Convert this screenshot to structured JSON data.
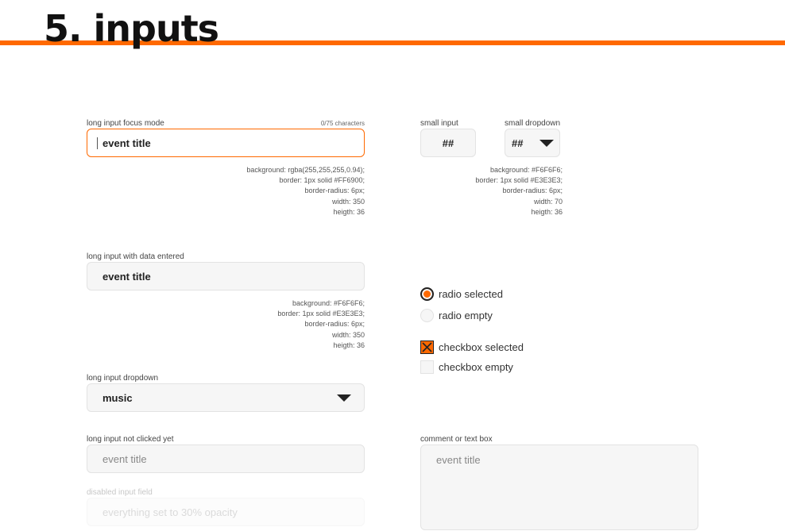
{
  "page": {
    "title": "5. inputs"
  },
  "focus_input": {
    "label": "long input focus mode",
    "counter": "0/75 characters",
    "value": "event title",
    "spec": [
      "background: rgba(255,255,255,0.94);",
      "border: 1px solid #FF6900;",
      "border-radius: 6px;",
      "width: 350",
      "heigth: 36"
    ]
  },
  "small_input": {
    "label": "small input",
    "value": "##"
  },
  "small_dropdown": {
    "label": "small dropdown",
    "value": "##",
    "spec": [
      "background: #F6F6F6;",
      "border: 1px solid #E3E3E3;",
      "border-radius: 6px;",
      "width: 70",
      "heigth: 36"
    ]
  },
  "data_input": {
    "label": "long input with data entered",
    "value": "event title",
    "spec": [
      "background: #F6F6F6;",
      "border: 1px solid #E3E3E3;",
      "border-radius: 6px;",
      "width: 350",
      "heigth: 36"
    ]
  },
  "long_dropdown": {
    "label": "long input dropdown",
    "value": "music"
  },
  "idle_input": {
    "label": "long input not clicked yet",
    "placeholder": "event title"
  },
  "disabled_input": {
    "label": "disabled input field",
    "placeholder": "everything set to 30% opacity"
  },
  "choices": {
    "radio_selected": "radio selected",
    "radio_empty": "radio empty",
    "checkbox_selected": "checkbox selected",
    "checkbox_empty": "checkbox empty"
  },
  "comment_box": {
    "label": "comment or text box",
    "placeholder": "event title"
  },
  "colors": {
    "accent": "#FF6900",
    "field_background": "#F6F6F6",
    "field_border": "#E3E3E3"
  },
  "icons": {
    "dropdown": "caret-down-icon",
    "checkbox": "x-mark-icon"
  }
}
